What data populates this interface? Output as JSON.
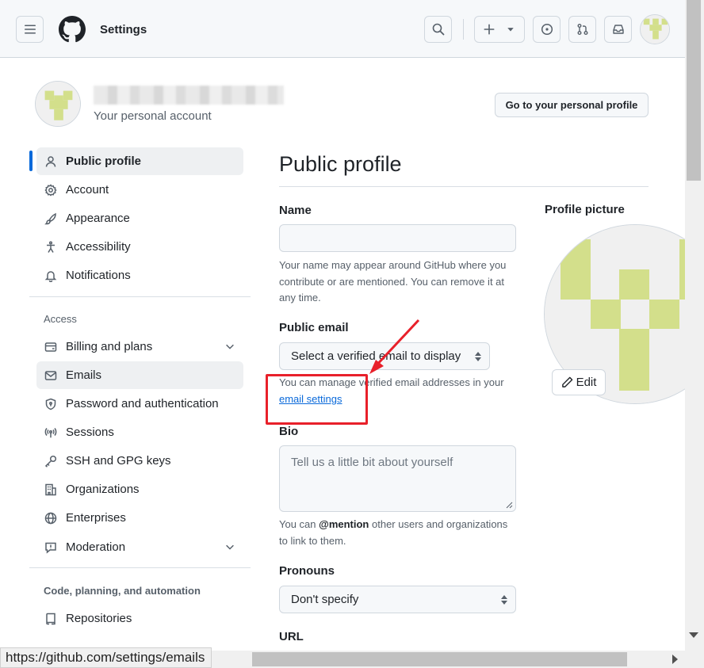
{
  "header": {
    "title": "Settings",
    "menu_icon": "hamburger-icon",
    "logo_icon": "github-logo",
    "buttons": [
      "search-icon",
      "plus-icon",
      "issues-icon",
      "pull-requests-icon",
      "inbox-icon"
    ]
  },
  "account": {
    "name": "",
    "subtitle": "Your personal account",
    "profile_button": "Go to your personal profile"
  },
  "sidebar": {
    "items": [
      {
        "label": "Public profile",
        "icon": "person-icon"
      },
      {
        "label": "Account",
        "icon": "gear-icon"
      },
      {
        "label": "Appearance",
        "icon": "paintbrush-icon"
      },
      {
        "label": "Accessibility",
        "icon": "accessibility-icon"
      },
      {
        "label": "Notifications",
        "icon": "bell-icon"
      }
    ],
    "access_header": "Access",
    "access_items": [
      {
        "label": "Billing and plans",
        "icon": "credit-card-icon"
      },
      {
        "label": "Emails",
        "icon": "mail-icon"
      },
      {
        "label": "Password and authentication",
        "icon": "shield-lock-icon"
      },
      {
        "label": "Sessions",
        "icon": "broadcast-icon"
      },
      {
        "label": "SSH and GPG keys",
        "icon": "key-icon"
      },
      {
        "label": "Organizations",
        "icon": "organization-icon"
      },
      {
        "label": "Enterprises",
        "icon": "globe-icon"
      },
      {
        "label": "Moderation",
        "icon": "report-icon"
      }
    ],
    "code_header": "Code, planning, and automation",
    "code_items": [
      {
        "label": "Repositories",
        "icon": "repo-icon"
      }
    ]
  },
  "main": {
    "title": "Public profile",
    "name_label": "Name",
    "name_value": "",
    "name_note": "Your name may appear around GitHub where you contribute or are mentioned. You can remove it at any time.",
    "email_label": "Public email",
    "email_select": "Select a verified email to display",
    "email_note_prefix": "You can manage verified email addresses in your",
    "email_note_link": "email settings",
    "bio_label": "Bio",
    "bio_placeholder": "Tell us a little bit about yourself",
    "bio_note_prefix": "You can",
    "bio_note_mention": "@mention",
    "bio_note_suffix": "other users and organizations to link to them.",
    "pronouns_label": "Pronouns",
    "pronouns_value": "Don't specify",
    "url_label": "URL",
    "picture_label": "Profile picture",
    "edit_label": "Edit"
  },
  "status_bar": {
    "url": "https://github.com/settings/emails"
  },
  "colors": {
    "accent": "#0969da",
    "identicon": "#d3df8b",
    "annotation": "#e8202a"
  }
}
